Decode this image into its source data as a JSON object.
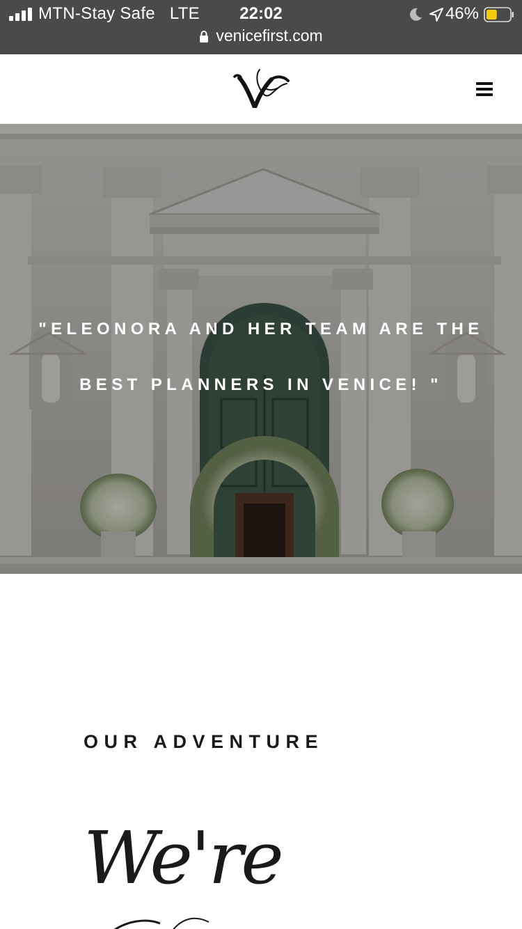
{
  "status_bar": {
    "carrier": "MTN-Stay Safe",
    "network": "LTE",
    "time": "22:02",
    "battery": "46%",
    "battery_level": 0.46,
    "url": "venicefirst.com",
    "background": "#4a4a48"
  },
  "header": {
    "logo_icon": "venice-first-monogram",
    "menu_icon": "hamburger-menu-icon"
  },
  "hero": {
    "quote_line_1": "\"ELEONORA AND HER TEAM ARE THE",
    "quote_line_2": "BEST PLANNERS IN VENICE! \""
  },
  "main": {
    "section_label": "OUR ADVENTURE",
    "script_heading": "We're"
  }
}
